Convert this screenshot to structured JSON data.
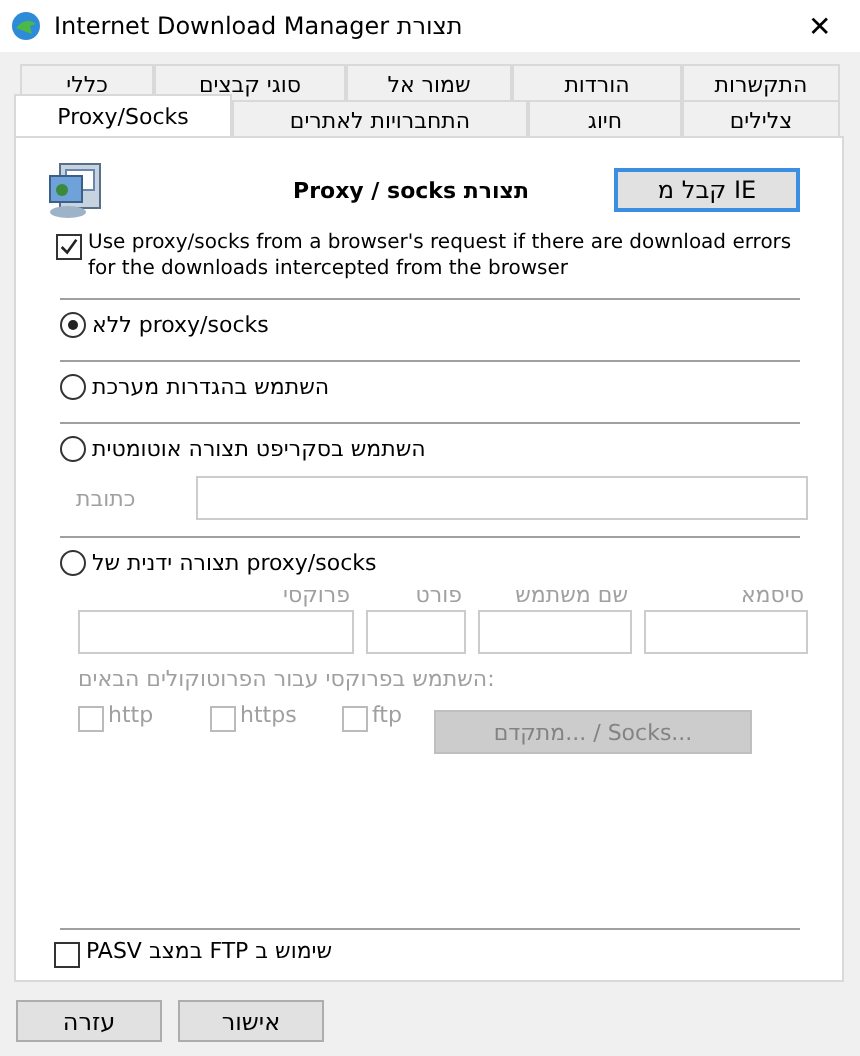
{
  "window": {
    "title": "Internet Download Manager תצורת",
    "close": "✕"
  },
  "tabs_back": [
    {
      "label": "התקשרות",
      "selected": false
    },
    {
      "label": "הורדות",
      "selected": false
    },
    {
      "label": "שמור אל",
      "selected": false
    },
    {
      "label": "סוגי קבצים",
      "selected": false
    },
    {
      "label": "כללי",
      "selected": false
    }
  ],
  "tabs_front": [
    {
      "label": "צלילים",
      "selected": false
    },
    {
      "label": "חיוג",
      "selected": false
    },
    {
      "label": "התחברויות לאתרים",
      "selected": false
    },
    {
      "label": "Proxy/Socks",
      "selected": true
    }
  ],
  "heading": "Proxy / socks תצורת",
  "ie_button": "קבל מ IE",
  "browser_option": {
    "label": "Use proxy/socks from a browser's request if there are download errors for the downloads intercepted from the browser",
    "checked": true
  },
  "modes": [
    {
      "label": "ללא proxy/socks",
      "selected": true
    },
    {
      "label": "השתמש בהגדרות מערכת",
      "selected": false
    },
    {
      "label": "השתמש בסקריפט תצורה אוטומטית",
      "selected": false
    },
    {
      "label": "תצורה ידנית של proxy/socks",
      "selected": false
    }
  ],
  "address": {
    "label": "כתובת",
    "disabled": true
  },
  "manual": {
    "disabled": true,
    "fields": [
      "סיסמא",
      "שם משתמש",
      "פורט",
      "פרוקסי"
    ],
    "protocols_label": "השתמש בפרוקסי עבור הפרוטוקולים הבאים:",
    "protocols": [
      {
        "label": "ftp",
        "checked": false
      },
      {
        "label": "https",
        "checked": false
      },
      {
        "label": "http",
        "checked": false
      }
    ],
    "advanced_button": "מתקדם... / Socks..."
  },
  "pasv": {
    "label": "שימוש ב FTP במצב PASV",
    "checked": false
  },
  "buttons": [
    "אישור",
    "עזרה"
  ]
}
